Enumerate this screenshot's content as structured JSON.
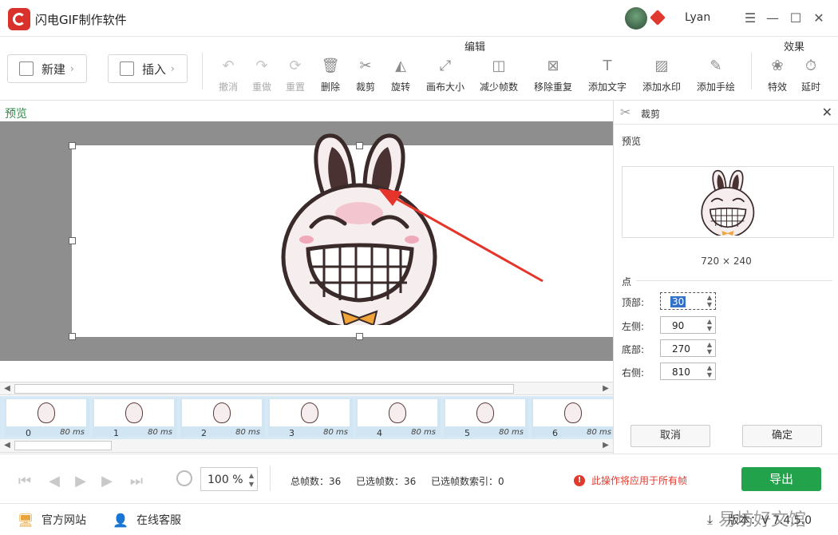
{
  "app": {
    "title": "闪电GIF制作软件",
    "username": "Lyan"
  },
  "toolbar": {
    "new_label": "新建",
    "insert_label": "插入",
    "edit_group": "编辑",
    "effect_group": "效果",
    "tools": [
      {
        "label": "撤消",
        "icon": "undo-icon",
        "enabled": false
      },
      {
        "label": "重做",
        "icon": "redo-icon",
        "enabled": false
      },
      {
        "label": "重置",
        "icon": "reset-icon",
        "enabled": false
      },
      {
        "label": "删除",
        "icon": "delete-icon",
        "enabled": true
      },
      {
        "label": "裁剪",
        "icon": "scissors-icon",
        "enabled": true
      },
      {
        "label": "旋转",
        "icon": "rotate-icon",
        "enabled": true
      },
      {
        "label": "画布大小",
        "icon": "canvas-size-icon",
        "enabled": true
      },
      {
        "label": "减少帧数",
        "icon": "reduce-frames-icon",
        "enabled": true
      },
      {
        "label": "移除重复",
        "icon": "remove-duplicate-icon",
        "enabled": true
      },
      {
        "label": "添加文字",
        "icon": "add-text-icon",
        "enabled": true
      },
      {
        "label": "添加水印",
        "icon": "watermark-icon",
        "enabled": true
      },
      {
        "label": "添加手绘",
        "icon": "pen-icon",
        "enabled": true
      }
    ],
    "effects": [
      {
        "label": "特效",
        "icon": "effects-icon"
      },
      {
        "label": "延时",
        "icon": "timer-icon"
      }
    ]
  },
  "preview": {
    "label": "预览"
  },
  "frames": [
    {
      "index": "0",
      "duration": "80 ms"
    },
    {
      "index": "1",
      "duration": "80 ms"
    },
    {
      "index": "2",
      "duration": "80 ms"
    },
    {
      "index": "3",
      "duration": "80 ms"
    },
    {
      "index": "4",
      "duration": "80 ms"
    },
    {
      "index": "5",
      "duration": "80 ms"
    },
    {
      "index": "6",
      "duration": "80 ms"
    }
  ],
  "crop_panel": {
    "title": "裁剪",
    "preview_label": "预览",
    "dimensions": "720 × 240",
    "points_label": "点",
    "fields": [
      {
        "label": "顶部:",
        "value": "30"
      },
      {
        "label": "左侧:",
        "value": "90"
      },
      {
        "label": "底部:",
        "value": "270"
      },
      {
        "label": "右侧:",
        "value": "810"
      }
    ],
    "cancel": "取消",
    "confirm": "确定"
  },
  "bottom": {
    "zoom": "100",
    "zoom_unit": "%",
    "total_frames": "总帧数：36",
    "selected_frames": "已选帧数：36",
    "selected_index": "已选帧数索引：0",
    "warning": "此操作将应用于所有帧",
    "export": "导出"
  },
  "footer": {
    "website": "官方网站",
    "service": "在线客服",
    "version": "版本：V 7.4.5.0",
    "watermark": "易坊好文馆"
  },
  "colors": {
    "accent_green": "#22a34b",
    "warning_red": "#e03a2f",
    "brand_red": "#d9312b"
  }
}
